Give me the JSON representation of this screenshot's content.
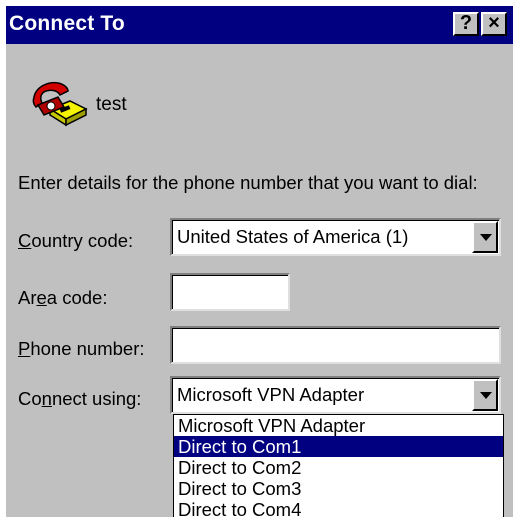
{
  "window": {
    "title": "Connect To",
    "help_button": "?",
    "close_button": "×"
  },
  "connection": {
    "name": "test",
    "icon": "phone-modem-icon"
  },
  "instructions": "Enter details for the phone number that you want to dial:",
  "form": {
    "country_code": {
      "label_pre": "",
      "label_key": "C",
      "label_post": "ountry code:",
      "value": "United States of America (1)"
    },
    "area_code": {
      "label_pre": "Ar",
      "label_key": "e",
      "label_post": "a code:",
      "value": ""
    },
    "phone_number": {
      "label_pre": "",
      "label_key": "P",
      "label_post": "hone number:",
      "value": ""
    },
    "connect_using": {
      "label_pre": "Co",
      "label_key": "n",
      "label_post": "nect using:",
      "value": "Microsoft VPN Adapter",
      "options": [
        "Microsoft VPN Adapter",
        "Direct to Com1",
        "Direct to Com2",
        "Direct to Com3",
        "Direct to Com4"
      ],
      "highlighted_option": "Direct to Com1"
    }
  },
  "colors": {
    "titlebar": "#000080",
    "face": "#c0c0c0",
    "highlight": "#000080"
  }
}
